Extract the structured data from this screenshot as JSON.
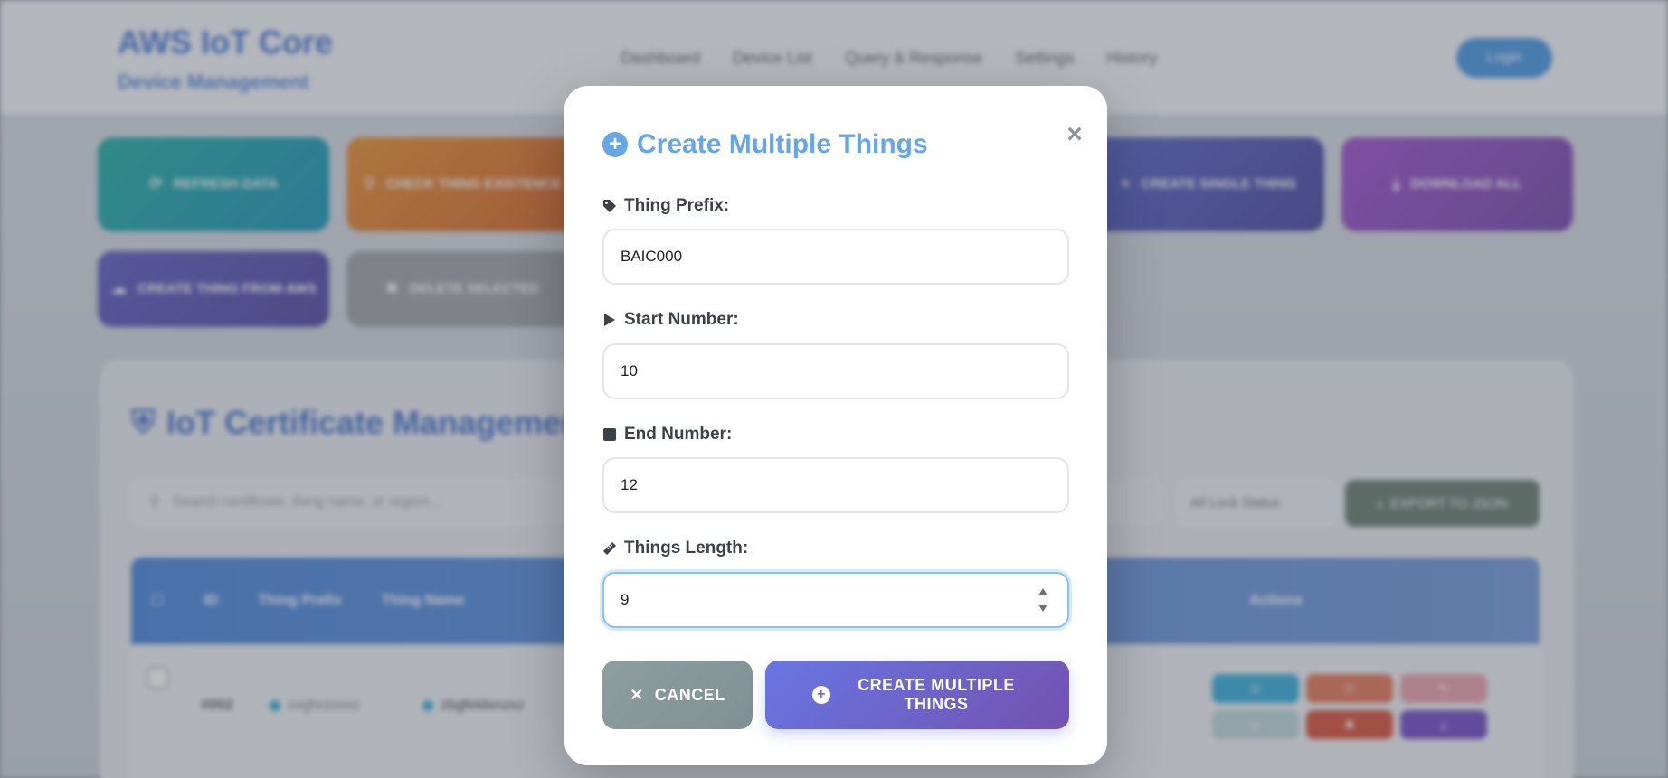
{
  "app": {
    "title": "AWS IoT Core",
    "subtitle": "Device Management",
    "nav": [
      "Dashboard",
      "Device List",
      "Query & Response",
      "Settings",
      "History"
    ],
    "login_label": "Login",
    "tiles": [
      {
        "label": "REFRESH DATA",
        "color": "#12a99a"
      },
      {
        "label": "CHECK THING EXISTENCE",
        "color": "#e0701c"
      },
      {
        "label": "CREATE SINGLE THING",
        "color": "#4a4fb8"
      },
      {
        "label": "DOWNLOAD ALL",
        "color": "#8b3fc0"
      },
      {
        "label": "CREATE THING FROM AWS",
        "color": "#5146b2"
      },
      {
        "label": "DELETE SELECTED",
        "color": "#8c8f94"
      }
    ],
    "panel_title": "IoT Certificate Management",
    "search_placeholder": "Search certificate, thing name, or region...",
    "filter_label": "All Lock Status",
    "export_label": "EXPORT TO JSON",
    "table_headers": [
      "ID",
      "Thing Prefix",
      "Thing Name",
      "Actions"
    ],
    "row": {
      "id": "#002",
      "col_a": "cvghrzosxz",
      "col_b": "zbgfeldxnzxz"
    }
  },
  "modal": {
    "title": "Create Multiple Things",
    "close_symbol": "×",
    "fields": {
      "prefix": {
        "label": "Thing Prefix:",
        "value": "BAIC000"
      },
      "start": {
        "label": "Start Number:",
        "value": "10"
      },
      "end": {
        "label": "End Number:",
        "value": "12"
      },
      "length": {
        "label": "Things Length:",
        "value": "9"
      }
    },
    "cancel_label": "CANCEL",
    "create_label": "CREATE MULTIPLE THINGS"
  },
  "colors": {
    "accent": "#64a6e6",
    "create_gradient_start": "#6876e3",
    "create_gradient_end": "#7352b0",
    "cancel": "#8a9b9e"
  }
}
